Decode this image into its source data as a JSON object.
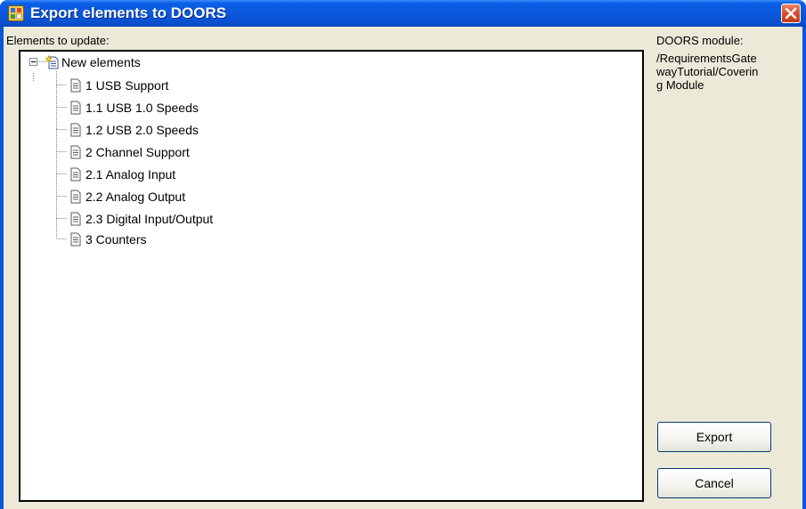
{
  "window": {
    "title": "Export elements to DOORS",
    "close_icon": "close-icon",
    "app_icon": "doors-app-icon"
  },
  "left_panel": {
    "label": "Elements to update:",
    "tree": {
      "root": {
        "label": "New elements",
        "icon": "new-elements-icon",
        "expanded": true
      },
      "children": [
        {
          "label": "1 USB Support",
          "icon": "document-icon"
        },
        {
          "label": "1.1 USB 1.0 Speeds",
          "icon": "document-icon"
        },
        {
          "label": "1.2 USB 2.0 Speeds",
          "icon": "document-icon"
        },
        {
          "label": "2 Channel Support",
          "icon": "document-icon"
        },
        {
          "label": "2.1 Analog Input",
          "icon": "document-icon"
        },
        {
          "label": "2.2 Analog Output",
          "icon": "document-icon"
        },
        {
          "label": "2.3 Digital Input/Output",
          "icon": "document-icon"
        },
        {
          "label": "3 Counters",
          "icon": "document-icon"
        }
      ]
    }
  },
  "right_panel": {
    "module_label": "DOORS module:",
    "module_path": "/RequirementsGatewayTutorial/Covering Module"
  },
  "buttons": {
    "export_label": "Export",
    "cancel_label": "Cancel"
  },
  "colors": {
    "titlebar": "#0a55dc",
    "dialog_face": "#ece9d8",
    "close_button": "#d9512f"
  }
}
